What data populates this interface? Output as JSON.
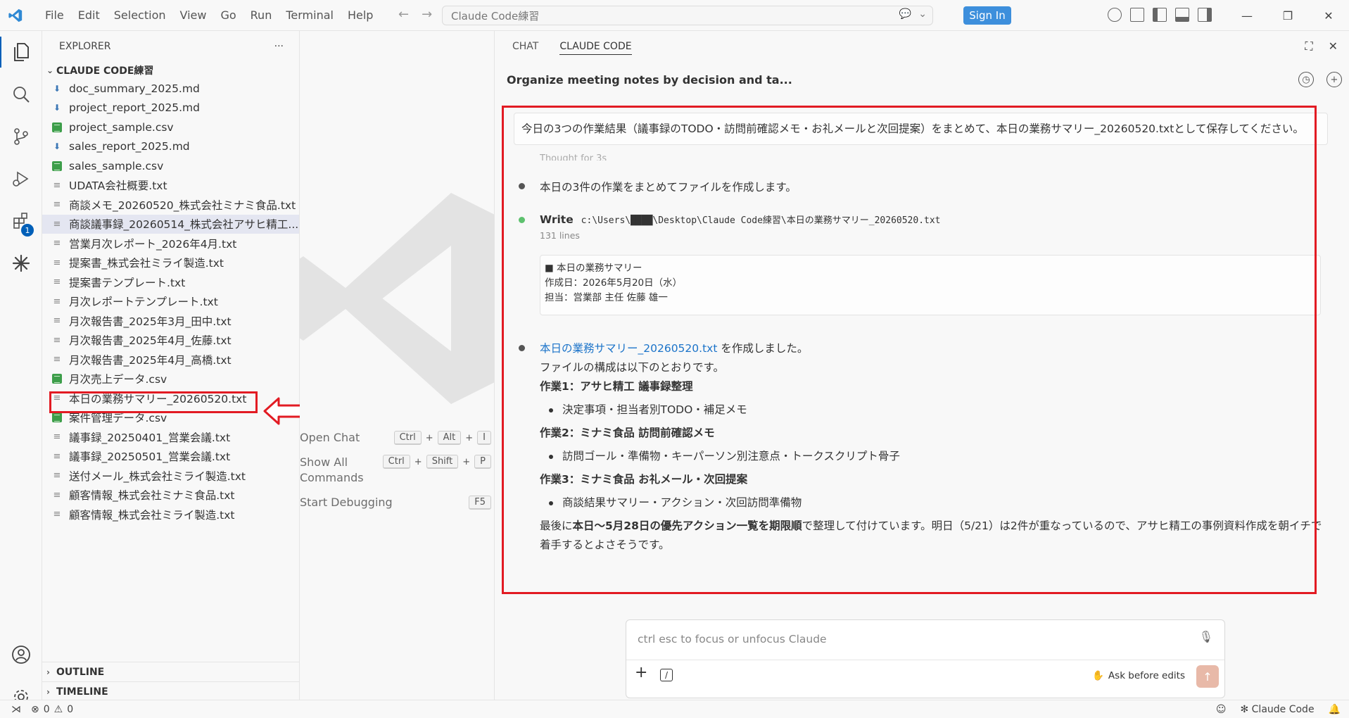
{
  "titlebar": {
    "menu": [
      "File",
      "Edit",
      "Selection",
      "View",
      "Go",
      "Run",
      "Terminal",
      "Help"
    ],
    "search": "Claude Code練習",
    "signin": "Sign In"
  },
  "activity": {
    "badge": "1"
  },
  "explorer": {
    "header": "EXPLORER",
    "more": "···",
    "folder": "CLAUDE CODE練習",
    "files": [
      {
        "name": "doc_summary_2025.md",
        "type": "md"
      },
      {
        "name": "project_report_2025.md",
        "type": "md"
      },
      {
        "name": "project_sample.csv",
        "type": "csv"
      },
      {
        "name": "sales_report_2025.md",
        "type": "md"
      },
      {
        "name": "sales_sample.csv",
        "type": "csv"
      },
      {
        "name": "UDATA会社概要.txt",
        "type": "txt"
      },
      {
        "name": "商談メモ_20260520_株式会社ミナミ食品.txt",
        "type": "txt"
      },
      {
        "name": "商談議事録_20260514_株式会社アサヒ精工....",
        "type": "txt"
      },
      {
        "name": "営業月次レポート_2026年4月.txt",
        "type": "txt"
      },
      {
        "name": "提案書_株式会社ミライ製造.txt",
        "type": "txt"
      },
      {
        "name": "提案書テンプレート.txt",
        "type": "txt"
      },
      {
        "name": "月次レポートテンプレート.txt",
        "type": "txt"
      },
      {
        "name": "月次報告書_2025年3月_田中.txt",
        "type": "txt"
      },
      {
        "name": "月次報告書_2025年4月_佐藤.txt",
        "type": "txt"
      },
      {
        "name": "月次報告書_2025年4月_高橋.txt",
        "type": "txt"
      },
      {
        "name": "月次売上データ.csv",
        "type": "csv"
      },
      {
        "name": "本日の業務サマリー_20260520.txt",
        "type": "txt"
      },
      {
        "name": "案件管理データ.csv",
        "type": "csv"
      },
      {
        "name": "議事録_20250401_営業会議.txt",
        "type": "txt"
      },
      {
        "name": "議事録_20250501_営業会議.txt",
        "type": "txt"
      },
      {
        "name": "送付メール_株式会社ミライ製造.txt",
        "type": "txt"
      },
      {
        "name": "顧客情報_株式会社ミナミ食品.txt",
        "type": "txt"
      },
      {
        "name": "顧客情報_株式会社ミライ製造.txt",
        "type": "txt"
      }
    ],
    "outline": "OUTLINE",
    "timeline": "TIMELINE"
  },
  "editor": {
    "shortcuts": [
      {
        "label": "Open Chat",
        "keys": [
          "Ctrl",
          "Alt",
          "I"
        ]
      },
      {
        "label": "Show All Commands",
        "keys": [
          "Ctrl",
          "Shift",
          "P"
        ]
      },
      {
        "label": "Start Debugging",
        "keys": [
          "F5"
        ]
      }
    ]
  },
  "panel": {
    "tabs": [
      "CHAT",
      "CLAUDE CODE"
    ],
    "title": "Organize meeting notes by decision and ta...",
    "user_message": "今日の3つの作業結果（議事録のTODO・訪問前確認メモ・お礼メールと次回提案）をまとめて、本日の業務サマリー_20260520.txtとして保存してください。",
    "thought": "Thought for 3s",
    "step1": "本日の3件の作業をまとめてファイルを作成します。",
    "write_label": "Write",
    "write_path": "c:\\Users\\████\\Desktop\\Claude Code練習\\本日の業務サマリー_20260520.txt",
    "lines": "131 lines",
    "code_lines": [
      "■ 本日の業務サマリー",
      "作成日：2026年5月20日（水）",
      "担当：営業部 主任 佐藤 雄一"
    ],
    "done_link": "本日の業務サマリー_20260520.txt",
    "done_suffix": " を作成しました。",
    "structure": "ファイルの構成は以下のとおりです。",
    "task1_title": "作業1：アサヒ精工 議事録整理",
    "task1_bullet": "決定事項・担当者別TODO・補足メモ",
    "task2_title": "作業2：ミナミ食品 訪問前確認メモ",
    "task2_bullet": "訪問ゴール・準備物・キーパーソン別注意点・トークスクリプト骨子",
    "task3_title": "作業3：ミナミ食品 お礼メール・次回提案",
    "task3_bullet": "商談結果サマリー・アクション・次回訪問準備物",
    "final_pre": "最後に",
    "final_bold": "本日〜5月28日の優先アクション一覧を期限順",
    "final_post": "で整理して付けています。明日（5/21）は2件が重なっているので、アサヒ精工の事例資料作成を朝イチで着手するとよさそうです。",
    "input_placeholder": "ctrl esc to focus or unfocus Claude",
    "ask_label": "Ask before edits"
  },
  "status": {
    "errors": "0",
    "warnings": "0",
    "claude": "✻ Claude Code"
  },
  "colors": {
    "accent": "#005fb8",
    "highlight_red": "#e21b23",
    "link": "#1b73c9"
  }
}
